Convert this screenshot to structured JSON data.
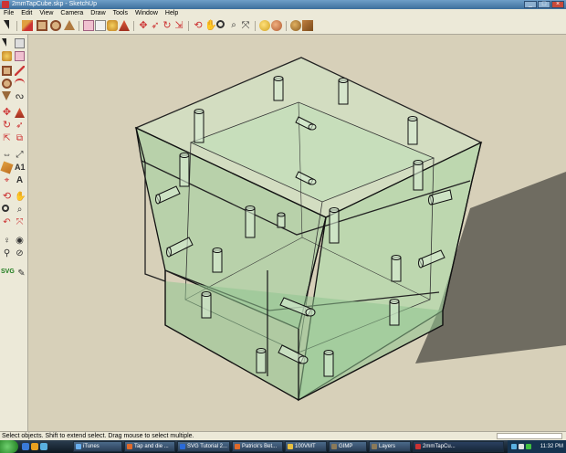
{
  "window": {
    "title": "2mmTapCube.skp - SketchUp"
  },
  "menu": [
    "File",
    "Edit",
    "View",
    "Camera",
    "Draw",
    "Tools",
    "Window",
    "Help"
  ],
  "toolbar": {
    "tools": [
      "select",
      "eraser",
      "paint-bucket",
      "rectangle",
      "circle",
      "push-pull",
      "offset",
      "move",
      "rotate",
      "scale",
      "follow-me",
      "orbit",
      "pan",
      "zoom",
      "zoom-extents",
      "top-view",
      "front-view",
      "iso-view",
      "components",
      "get-models",
      "share-model",
      "place-model",
      "3d-warehouse"
    ]
  },
  "sidebar": {
    "svg_label": "SVG"
  },
  "status": {
    "message": "Select objects. Shift to extend select. Drag mouse to select multiple."
  },
  "taskbar": {
    "tasks": [
      "iTunes",
      "Tap and die ...",
      "SVG Tutorial 2...",
      "Patrick's Bet...",
      "100VMT",
      "GIMP",
      "Layers",
      "2mmTapCu..."
    ],
    "clock": "11:32 PM"
  },
  "colors": {
    "sky": "#ffffff",
    "ground": "#d7d0b9",
    "glass": "#a6d8a6",
    "shadow": "#6f6c61",
    "edge": "#111111"
  }
}
